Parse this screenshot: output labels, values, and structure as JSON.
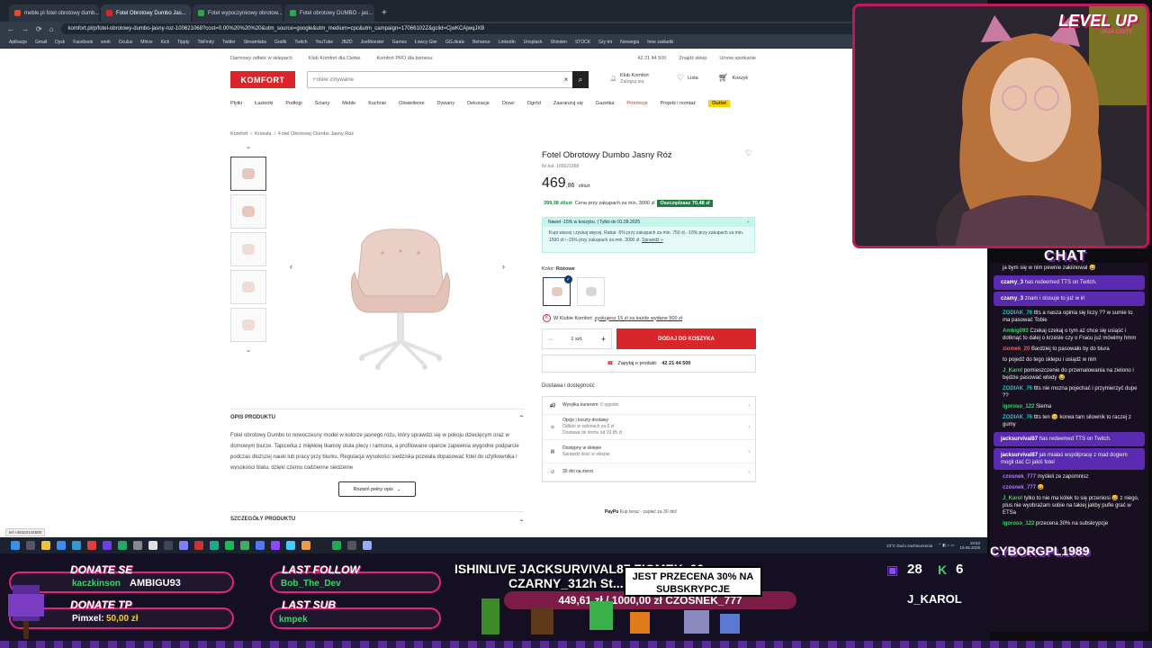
{
  "browser": {
    "tabs": [
      {
        "label": "meble.pl fotel obrotowy dumb...",
        "color": "#e34c26"
      },
      {
        "label": "Fotel Obrotowy Dumbo Jas...",
        "color": "#d9262b",
        "active": true
      },
      {
        "label": "Fotel wypoczynkowy obrotow...",
        "color": "#2aa84a"
      },
      {
        "label": "Fotel obrotowy DUMBO - jas...",
        "color": "#2aa84a"
      }
    ],
    "url": "komfort.pl/p/fotel-obrotowy-dumbo-jasny-roz-100621068?cost=0.00%20%20%20&utm_source=google&utm_medium=cpc&utm_campaign=17066102Z&gclid=CjwKCAjwqJXB",
    "bookmarks": [
      "Aplikacje",
      "Gmail",
      "Dysk",
      "Facebook",
      "work",
      "Oculus",
      "Mhive",
      "Kick",
      "Tippty",
      "TikFinity",
      "Twitter",
      "Streamlabs",
      "Grafik",
      "Twitch",
      "YouTube",
      "JBZD",
      "JoeMonster",
      "Games",
      "Łowcy Gier",
      "GG.deals",
      "Behance",
      "LinkedIn",
      "Unsplash",
      "Shinden",
      "STOCK",
      "Gry tnt",
      "Norwegia",
      "Inne zakładki"
    ],
    "status_url": "tel:+48422144500"
  },
  "site": {
    "top_links": [
      "Darmowy odbiór w sklepach",
      "Klub Komfort dla Ciebie",
      "Komfort PRO dla biznesu"
    ],
    "top_right": [
      "42 21 44 500",
      "Znajdź sklep",
      "Umów spotkanie"
    ],
    "logo": "KOMFORT",
    "search_placeholder": "Fotele zmywalne",
    "club_label": "Klub Komfort",
    "club_sub": "Zaloguj się",
    "list_label": "Lista",
    "cart_label": "Koszyk",
    "categories": [
      "Płytki",
      "Łazienki",
      "Podłogi",
      "Ściany",
      "Meble",
      "Kuchnie",
      "Oświetlenie",
      "Dywany",
      "Dekoracje",
      "Drzwi",
      "Ogród",
      "Zaaranżuj się",
      "Gazetka",
      "Promocje",
      "Projekt i montaż",
      "Outlet"
    ],
    "breadcrumb": [
      "Komfort",
      "Krzesła",
      "Fotel Obrotowy Dumbo Jasny Róż"
    ]
  },
  "product": {
    "name": "Fotel Obrotowy Dumbo Jasny Róż",
    "sku": "Nr kat. 100621068",
    "price_int": "469",
    "price_dec": ",86",
    "price_unit": "zł/szt",
    "club_price": "399,38 zł/szt",
    "club_price_note": "Cena przy zakupach za min. 3000 zł",
    "savings_badge": "Oszczędzasz 70,48 zł",
    "promo_head": "Nawet -15% w koszyku. | Tylko do 01.09.2025",
    "promo_body": "Kupi więcej i zyskaj więcej. Rabat -5% przy zakupach za min. 750 zł, -10% przy zakupach za min. 1500 zł i -15% przy zakupach za min. 3000 zł.",
    "promo_link": "Sprawdź »",
    "color_label": "Kolor:",
    "color_value": "Różowe",
    "club_points": "W Klubie Komfort",
    "club_points_link": "zyskujesz 15 zł za każde wydane 500 zł",
    "qty": "1 szt.",
    "add_to_cart": "DODAJ DO KOSZYKA",
    "ask_label": "Zapytaj o produkt:",
    "ask_phone": "42 21 44 500",
    "delivery_title": "Dostawa i dostępność",
    "delivery": [
      {
        "icon": "truck",
        "title": "Wysyłka kurierem:",
        "sub": "6 tygodni"
      },
      {
        "icon": "box",
        "title": "Opcje i koszty dostawy",
        "sub": "Odbiór w salonach za 0 zł",
        "sub2": "Dostawa do domu od 19,95 zł"
      },
      {
        "icon": "store",
        "title": "Dostępny w sklepie",
        "sub": "Sprawdź ilość w sklepie"
      },
      {
        "icon": "return",
        "title": "30 dni na zwrot",
        "sub": ""
      }
    ],
    "paypo": "PayPo",
    "paypo_text": "Kup teraz - zapłać za 30 dni!",
    "desc_title": "OPIS PRODUKTU",
    "desc_text": "Fotel obrotowy Dumbo to nowoczesny model w kolorze jasnego różu, który sprawdzi się w pokoju dziecięcym oraz w domowym biurze. Tapicerka z miękkiej tkaniny otula plecy i ramiona, a profilowane oparcie zapewnia wygodne podparcie podczas dłuższej nauki lub pracy przy biurku. Regulacja wysokości siedziska pozwala dopasować fotel do użytkownika i wysokości blatu, dzięki czemu codzienne siedzenie",
    "desc_more": "Rozwiń pełny opis",
    "details_title": "SZCZEGÓŁY PRODUKTU"
  },
  "taskbar": {
    "time": "19:53",
    "date": "19.08.2025",
    "weather": "23°C Dużo zachmurzenia"
  },
  "stream": {
    "brand": "LEVEL UP",
    "brand_sub": "JAJA CIOTY",
    "chat_title": "CHAT",
    "chat": [
      {
        "user": "",
        "text": "ja bym się w nim pewnie zakiinowal 😅",
        "color": "#ddd"
      },
      {
        "user": "czamy_3",
        "text": "has redeemed TTS on Twitch.",
        "redeem": true
      },
      {
        "user": "czamy_3",
        "text": "znam i stosuje to już w iri",
        "redeem": true
      },
      {
        "user": "ZODIAK_76",
        "text": "ttts a nasza opinia się liczy ?? w sumie to ma pasować Tobie",
        "color": "#1ec8c8"
      },
      {
        "user": "Ambig093",
        "text": "Czekaj czekaj o tym aż chce się usiąść i dotknąć to dalej o krzesle czy o Fracu już mówimy hmm",
        "color": "#3cd36b"
      },
      {
        "user": "ziomek_20",
        "text": "Bardziej to pasowało by do biura",
        "color": "#ff5b5b"
      },
      {
        "user": "",
        "text": "to pojedź do tego sklepu i usiądź w nim",
        "color": "#ddd"
      },
      {
        "user": "J_Karol",
        "text": "pomieszczenie do przemalowania na zielono i będzie pasować wtedy 😂",
        "color": "#3cd36b"
      },
      {
        "user": "ZODIAK_76",
        "text": "ttts nie mozna pojechać i przymierzyć dupe ??",
        "color": "#1ec8c8"
      },
      {
        "user": "igoroso_122",
        "text": "Siema",
        "color": "#3cd36b"
      },
      {
        "user": "ZODIAK_76",
        "text": "ttts ten 😊 korwa tam silownik to raczej z gumy",
        "color": "#1ec8c8"
      },
      {
        "user": "jacksurvival87",
        "text": "has redeemed TTS on Twitch.",
        "redeem": true
      },
      {
        "user": "jacksurvival87",
        "text": "jak miałaś współpracę z mad dogiem mogli dać Ci jakiś fotel",
        "redeem": true
      },
      {
        "user": "czosnek_777",
        "text": "myśleli ze zapomnisz",
        "color": "#b07bff"
      },
      {
        "user": "czosnek_777",
        "text": "😀",
        "color": "#b07bff"
      },
      {
        "user": "J_Karol",
        "text": "tylko to nie ma kółek to się przeniosi 😅 z niego, plus nie wyobrażam sobie na takiej jakby pufie grać w ETSa",
        "color": "#3cd36b"
      },
      {
        "user": "igoroso_122",
        "text": "przecena 30% na subskrypcje",
        "color": "#3cd36b"
      }
    ],
    "donate_se_label": "DONATE SE",
    "donate_se_user": "kaczkinson",
    "donate_se_val": "AMBIGU93",
    "donate_tp_label": "DONATE TP",
    "donate_tp_user": "Pimxel:",
    "donate_tp_val": "50,00 zł",
    "last_follow_label": "LAST FOLLOW",
    "last_follow": "Bob_The_Dev",
    "last_sub_label": "LAST SUB",
    "last_sub": "kmpek",
    "subgoal_top": "ISHINLIVE    JACKSURVIVAL87    ZIOMEK_20",
    "subgoal_line2": "CZARNY_312h St...",
    "promo_banner": "JEST PRZECENA 30% NA SUBSKRYPCJE",
    "goal": "449,61 zł / 1000,00 zł",
    "goal_user": "CZOSNEK_777",
    "count_subs": "28",
    "count_k": "6",
    "cyborg": "CYBORGPL1989",
    "jkarol": "J_KAROL"
  }
}
